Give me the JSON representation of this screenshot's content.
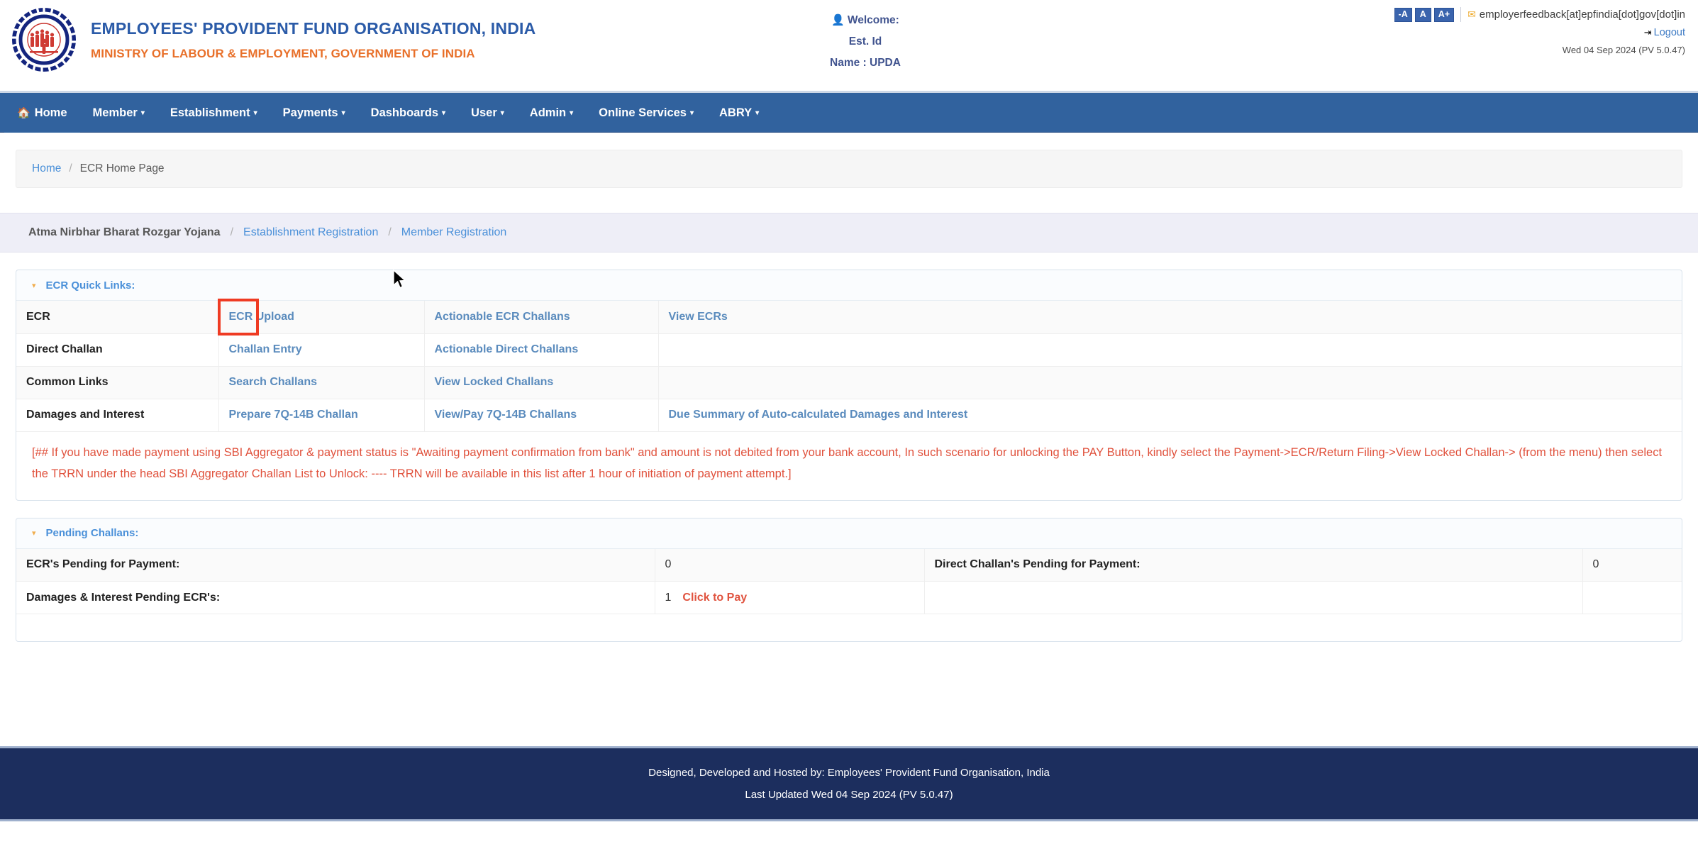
{
  "header": {
    "org_title": "EMPLOYEES' PROVIDENT FUND ORGANISATION, INDIA",
    "ministry": "MINISTRY OF LABOUR & EMPLOYMENT, GOVERNMENT OF INDIA",
    "logo_icon": "epfo-emblem-icon",
    "welcome_label": "Welcome:",
    "est_id": "Est. Id",
    "name": "Name : UPDA",
    "user_icon": "user-icon",
    "accessibility": {
      "decrease": "-A",
      "normal": "A",
      "increase": "A+"
    },
    "mail_icon": "envelope-icon",
    "feedback_email": "employerfeedback[at]epfindia[dot]gov[dot]in",
    "logout_icon": "logout-icon",
    "logout_label": "Logout",
    "date_version": "Wed 04 Sep 2024 (PV 5.0.47)",
    "colors": {
      "title_blue": "#2b5ba8",
      "ministry_orange": "#e8702a",
      "nav_blue": "#31629e",
      "footer_navy": "#1c2e5e",
      "link_blue": "#5a8bbd",
      "notice_red": "#e0513c",
      "highlight_red": "#ef3b23"
    }
  },
  "nav": {
    "home_icon": "home-icon",
    "items": [
      {
        "label": "Home",
        "caret": false,
        "icon": "home-icon"
      },
      {
        "label": "Member",
        "caret": true
      },
      {
        "label": "Establishment",
        "caret": true
      },
      {
        "label": "Payments",
        "caret": true
      },
      {
        "label": "Dashboards",
        "caret": true
      },
      {
        "label": "User",
        "caret": true
      },
      {
        "label": "Admin",
        "caret": true
      },
      {
        "label": "Online Services",
        "caret": true
      },
      {
        "label": "ABRY",
        "caret": true
      }
    ],
    "caret_glyph": "▾"
  },
  "breadcrumb": {
    "home": "Home",
    "separator": "/",
    "current": "ECR Home Page"
  },
  "subnav": {
    "first": "Atma Nirbhar Bharat Rozgar Yojana",
    "separator": "/",
    "links": [
      "Establishment Registration",
      "Member Registration"
    ]
  },
  "quick_links": {
    "panel_title": "ECR Quick Links:",
    "caret_glyph": "▾",
    "rows": [
      {
        "label": "ECR",
        "col2": "ECR Upload",
        "col3": "Actionable ECR Challans",
        "col4": "View ECRs",
        "highlighted": true
      },
      {
        "label": "Direct Challan",
        "col2": "Challan Entry",
        "col3": "Actionable Direct Challans",
        "col4": "",
        "highlighted": false
      },
      {
        "label": "Common Links",
        "col2": "Search Challans",
        "col3": "View Locked Challans",
        "col4": "",
        "highlighted": false
      },
      {
        "label": "Damages and Interest",
        "col2": "Prepare 7Q-14B Challan",
        "col3": "View/Pay 7Q-14B Challans",
        "col4": "Due Summary of Auto-calculated Damages and Interest",
        "highlighted": false
      }
    ],
    "notice": "[## If you have made payment using SBI Aggregator & payment status is \"Awaiting payment confirmation from bank\" and amount is not debited from your bank account, In such scenario for unlocking the PAY Button, kindly select the Payment->ECR/Return Filing->View Locked Challan-> (from the menu) then select the TRRN under the head SBI Aggregator Challan List to Unlock: ---- TRRN will be available in this list after 1 hour of initiation of payment attempt.]"
  },
  "pending_challans": {
    "panel_title": "Pending Challans:",
    "caret_glyph": "▾",
    "rows": [
      {
        "label1": "ECR's Pending for Payment:",
        "value1": "0",
        "action1": "",
        "label2": "Direct Challan's Pending for Payment:",
        "value2": "0"
      },
      {
        "label1": "Damages & Interest Pending ECR's:",
        "value1": "1",
        "action1": "Click to Pay",
        "label2": "",
        "value2": ""
      }
    ]
  },
  "footer": {
    "line1": "Designed, Developed and Hosted by: Employees' Provident Fund Organisation, India",
    "line2": "Last Updated Wed 04 Sep 2024 (PV 5.0.47)"
  }
}
